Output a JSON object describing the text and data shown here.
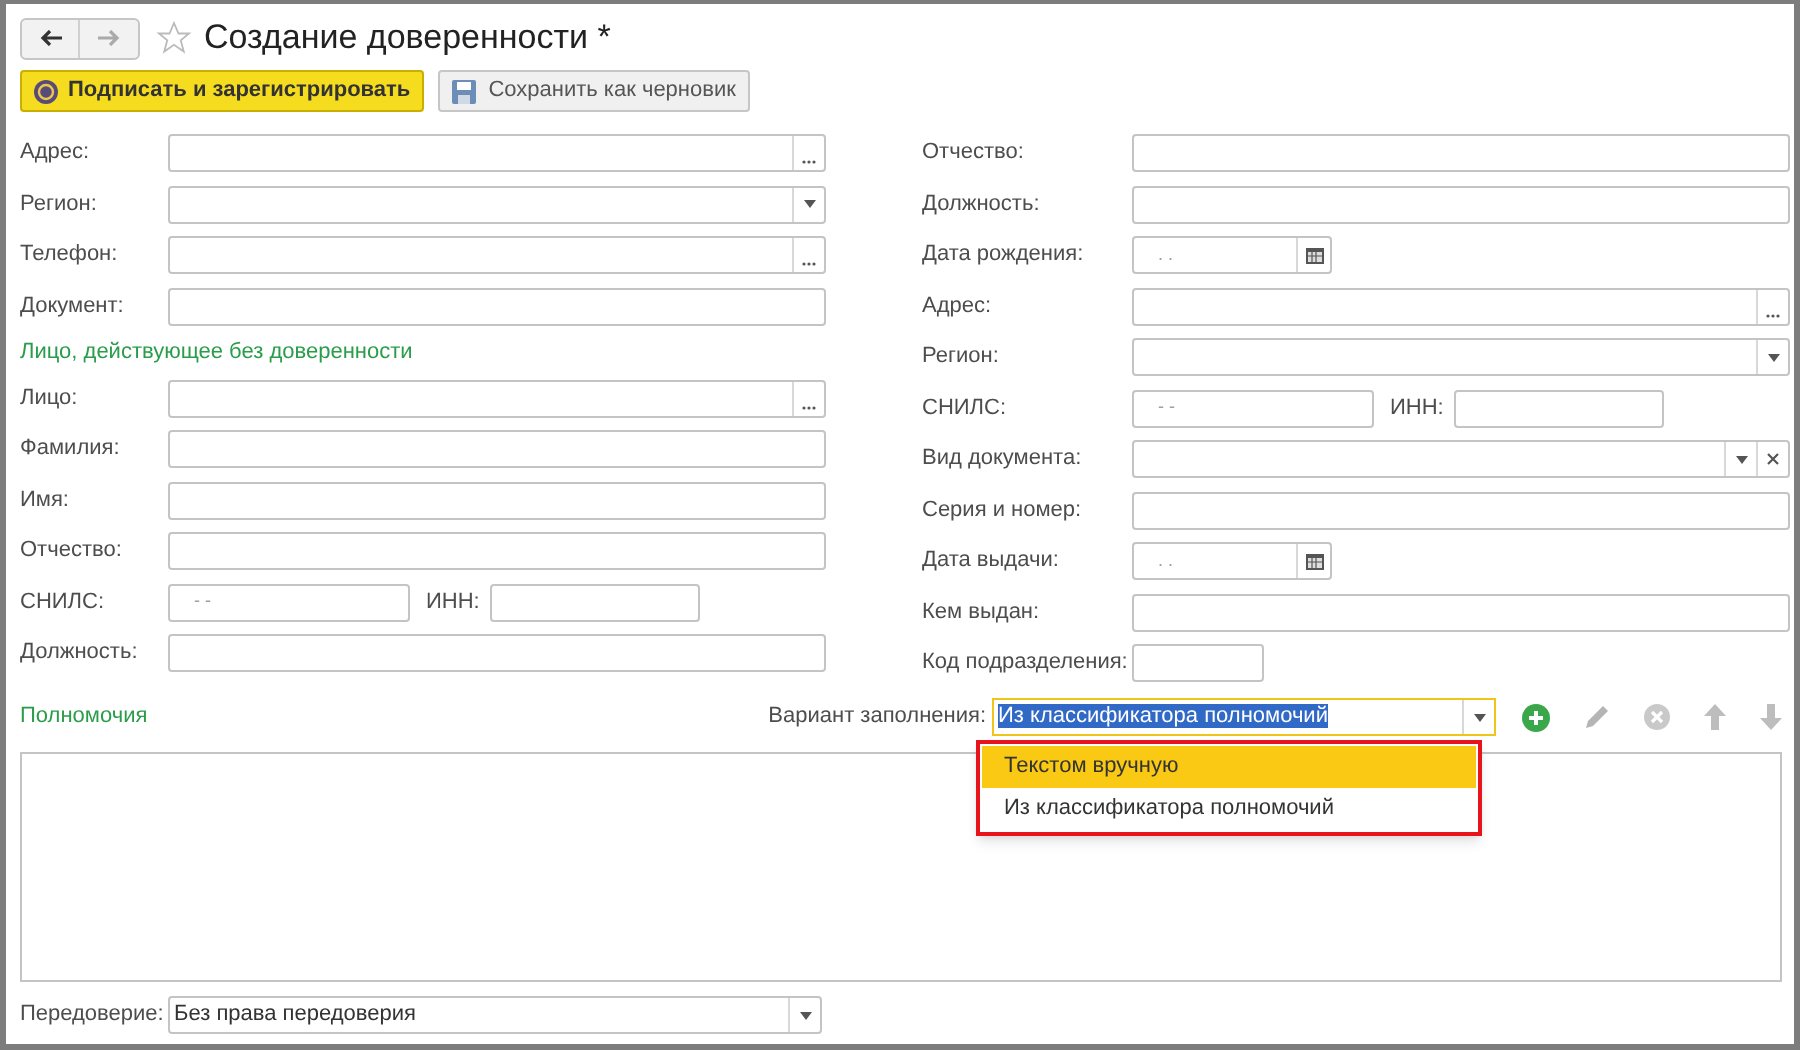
{
  "window": {
    "title": "Создание доверенности *",
    "favorite": false
  },
  "toolbar": [
    {
      "label": "Подписать и зарегистрировать",
      "kind": "primary"
    },
    {
      "label": "Сохранить как черновик",
      "kind": "secondary"
    }
  ],
  "left_fields": [
    {
      "kind": "choice",
      "label": "Адрес:"
    },
    {
      "kind": "select",
      "label": "Регион:"
    },
    {
      "kind": "choice",
      "label": "Телефон:"
    },
    {
      "kind": "text",
      "label": "Документ:"
    },
    {
      "kind": "heading",
      "label": "Лицо, действующее без доверенности"
    },
    {
      "kind": "choice",
      "label": "Лицо:"
    },
    {
      "kind": "text",
      "label": "Фамилия:"
    },
    {
      "kind": "text",
      "label": "Имя:"
    },
    {
      "kind": "text",
      "label": "Отчество:"
    },
    {
      "kind": "snils",
      "label": "СНИЛС:",
      "placeholder": "-  -",
      "inn_label": "ИНН:"
    },
    {
      "kind": "text",
      "label": "Должность:"
    }
  ],
  "right_fields": [
    {
      "kind": "text",
      "label": "Отчество:"
    },
    {
      "kind": "text",
      "label": "Должность:"
    },
    {
      "kind": "date",
      "label": "Дата рождения:",
      "placeholder": ".  ."
    },
    {
      "kind": "choice",
      "label": "Адрес:"
    },
    {
      "kind": "select",
      "label": "Регион:"
    },
    {
      "kind": "snils",
      "label": "СНИЛС:",
      "placeholder": "-  -",
      "inn_label": "ИНН:"
    },
    {
      "kind": "select_clear",
      "label": "Вид документа:"
    },
    {
      "kind": "text",
      "label": "Серия и номер:"
    },
    {
      "kind": "date",
      "label": "Дата выдачи:",
      "placeholder": ".  ."
    },
    {
      "kind": "text",
      "label": "Кем выдан:"
    },
    {
      "kind": "short",
      "label": "Код подразделения:"
    }
  ],
  "authority": {
    "title": "Полномочия",
    "fill_label": "Вариант заполнения:",
    "fill_value": "Из классификатора полномочий",
    "fill_value_highlighted": true,
    "options": [
      {
        "label": "Текстом вручную",
        "selected": true
      },
      {
        "label": "Из классификатора полномочий",
        "selected": false
      }
    ]
  },
  "delegation": {
    "label": "Передоверие:",
    "value": "Без права передоверия"
  }
}
